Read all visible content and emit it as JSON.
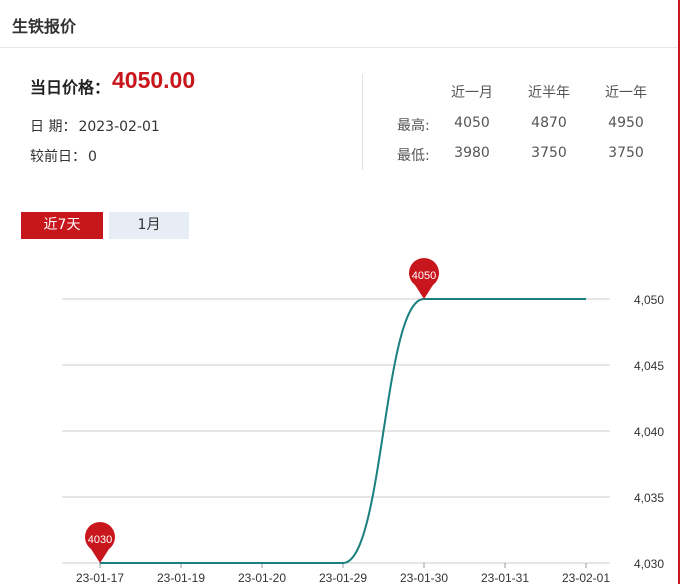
{
  "header": {
    "title": "生铁报价"
  },
  "summary": {
    "price_label": "当日价格：",
    "price_value": "4050.00",
    "date_label": "日 期：",
    "date_value": "2023-02-01",
    "change_label": "较前日：",
    "change_value": "0"
  },
  "stats": {
    "columns": [
      "近一月",
      "近半年",
      "近一年"
    ],
    "rows": [
      {
        "label": "最高:",
        "values": [
          "4050",
          "4870",
          "4950"
        ]
      },
      {
        "label": "最低:",
        "values": [
          "3980",
          "3750",
          "3750"
        ]
      }
    ]
  },
  "tabs": [
    {
      "label": "近7天",
      "active": true
    },
    {
      "label": "1月",
      "active": false
    }
  ],
  "colors": {
    "accent": "#c8161d",
    "line": "#1a7f7f",
    "grid": "#cccccc",
    "tab_idle_bg": "#e6edf5"
  },
  "chart_data": {
    "type": "line",
    "categories": [
      "23-01-17",
      "23-01-19",
      "23-01-20",
      "23-01-29",
      "23-01-30",
      "23-01-31",
      "23-02-01"
    ],
    "values": [
      4030,
      4030,
      4030,
      4030,
      4050,
      4050,
      4050
    ],
    "ylim": [
      4030,
      4050
    ],
    "yticks": [
      4030,
      4035,
      4040,
      4045,
      4050
    ],
    "ytick_labels": [
      "4,030",
      "4,035",
      "4,040",
      "4,045",
      "4,050"
    ],
    "y_axis_side": "right",
    "grid": true,
    "markers": [
      {
        "label": "4030",
        "category": "23-01-17",
        "value": 4030,
        "kind": "min"
      },
      {
        "label": "4050",
        "category": "23-01-30",
        "value": 4050,
        "kind": "max"
      }
    ]
  }
}
